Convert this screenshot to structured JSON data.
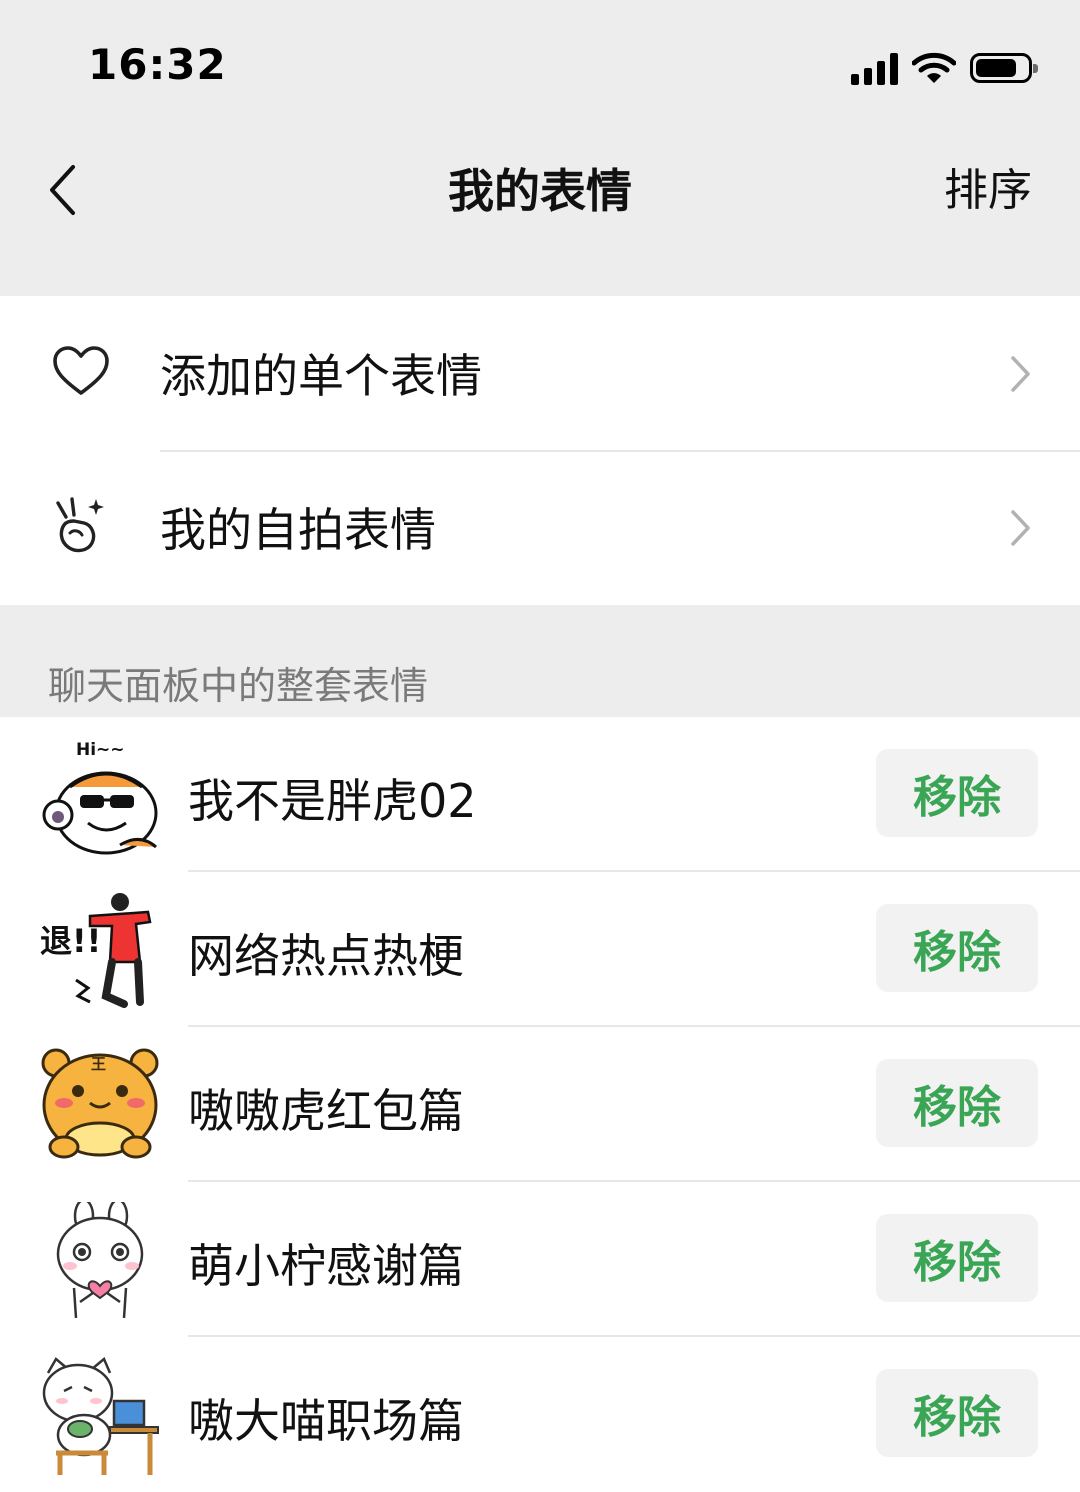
{
  "status_bar": {
    "time": "16:32"
  },
  "nav": {
    "title": "我的表情",
    "sort_label": "排序"
  },
  "menu": [
    {
      "label": "添加的单个表情",
      "icon": "heart-icon"
    },
    {
      "label": "我的自拍表情",
      "icon": "victory-hand-icon"
    }
  ],
  "section": {
    "header": "聊天面板中的整套表情"
  },
  "sticker_packs": [
    {
      "name": "我不是胖虎02",
      "thumb_caption": "Hi~~",
      "remove_label": "移除"
    },
    {
      "name": "网络热点热梗",
      "thumb_caption": "退!!",
      "remove_label": "移除"
    },
    {
      "name": "嗷嗷虎红包篇",
      "thumb_caption": "王",
      "remove_label": "移除"
    },
    {
      "name": "萌小柠感谢篇",
      "remove_label": "移除"
    },
    {
      "name": "嗷大喵职场篇",
      "remove_label": "移除"
    }
  ],
  "colors": {
    "accent": "#3aa655",
    "nav_bg": "#ededed",
    "remove_bg": "#f2f2f2"
  }
}
